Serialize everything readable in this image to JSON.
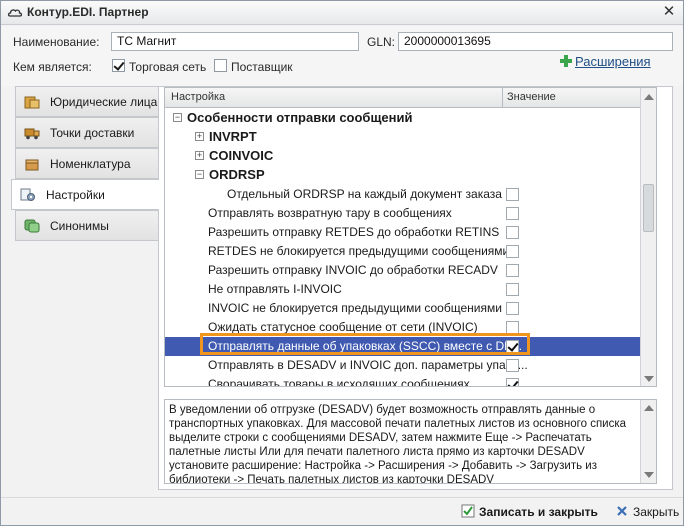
{
  "window": {
    "title": "Контур.EDI. Партнер"
  },
  "form": {
    "name_label": "Наименование:",
    "name_value": "ТС Магнит",
    "gln_label": "GLN:",
    "gln_value": "2000000013695",
    "role_label": "Кем является:",
    "retail_label": "Торговая сеть",
    "retail_checked": true,
    "supplier_label": "Поставщик",
    "supplier_checked": false,
    "extensions_label": "Расширения"
  },
  "tabs": [
    {
      "label": "Юридические лица",
      "icon": "legal-entity-icon",
      "active": false
    },
    {
      "label": "Точки доставки",
      "icon": "delivery-truck-icon",
      "active": false
    },
    {
      "label": "Номенклатура",
      "icon": "box-icon",
      "active": false
    },
    {
      "label": "Настройки",
      "icon": "settings-icon",
      "active": true
    },
    {
      "label": "Синонимы",
      "icon": "synonyms-icon",
      "active": false
    }
  ],
  "grid": {
    "col_setting": "Настройка",
    "col_value": "Значение",
    "rows": [
      {
        "text": "Особенности отправки сообщений",
        "level": 0,
        "bold": true,
        "expander": "minus",
        "checkbox": null
      },
      {
        "text": "INVRPT",
        "level": 1,
        "bold": true,
        "expander": "plus",
        "checkbox": null
      },
      {
        "text": "COINVOIC",
        "level": 1,
        "bold": true,
        "expander": "plus",
        "checkbox": null
      },
      {
        "text": "ORDRSP",
        "level": 1,
        "bold": true,
        "expander": "minus",
        "checkbox": null
      },
      {
        "text": "Отдельный ORDRSP на каждый документ заказа",
        "level": 2,
        "bold": false,
        "expander": null,
        "checkbox": false
      },
      {
        "text": "Отправлять возвратную тару в сообщениях",
        "level": 1,
        "bold": false,
        "expander": null,
        "checkbox": false
      },
      {
        "text": "Разрешить отправку RETDES до обработки RETINS",
        "level": 1,
        "bold": false,
        "expander": null,
        "checkbox": false
      },
      {
        "text": "RETDES не блокируется предыдущими сообщениями",
        "level": 1,
        "bold": false,
        "expander": null,
        "checkbox": false
      },
      {
        "text": "Разрешить отправку INVOIC до обработки RECADV",
        "level": 1,
        "bold": false,
        "expander": null,
        "checkbox": false
      },
      {
        "text": "Не отправлять I-INVOIC",
        "level": 1,
        "bold": false,
        "expander": null,
        "checkbox": false
      },
      {
        "text": "INVOIC не блокируется предыдущими сообщениями",
        "level": 1,
        "bold": false,
        "expander": null,
        "checkbox": false
      },
      {
        "text": "Ожидать статусное сообщение от сети (INVOIC)",
        "level": 1,
        "bold": false,
        "expander": null,
        "checkbox": false
      },
      {
        "text": "Отправлять данные об упаковках (SSCC) вместе с DE...",
        "level": 1,
        "bold": false,
        "expander": null,
        "checkbox": true,
        "selected": true
      },
      {
        "text": "Отправлять в DESADV и INVOIC доп. параметры упако...",
        "level": 1,
        "bold": false,
        "expander": null,
        "checkbox": false
      },
      {
        "text": "Сворачивать товары в исходящих сообщениях",
        "level": 1,
        "bold": false,
        "expander": null,
        "checkbox": true
      }
    ]
  },
  "description": "В уведомлении об отгрузке (DESADV) будет возможность отправлять данные о транспортных упаковках. Для массовой печати палетных листов из основного списка выделите строки с сообщениями DESADV, затем нажмите Еще -> Распечатать палетные листы Или для печати палетного листа прямо из карточки DESADV установите расширение: Настройка -> Расширения -> Добавить -> Загрузить из библиотеки -> Печать палетных листов из карточки DESADV",
  "buttons": {
    "save_close": "Записать и закрыть",
    "close": "Закрыть"
  },
  "colors": {
    "selection": "#3f5ab0",
    "highlight": "#f0961e",
    "link": "#1f4f86"
  }
}
